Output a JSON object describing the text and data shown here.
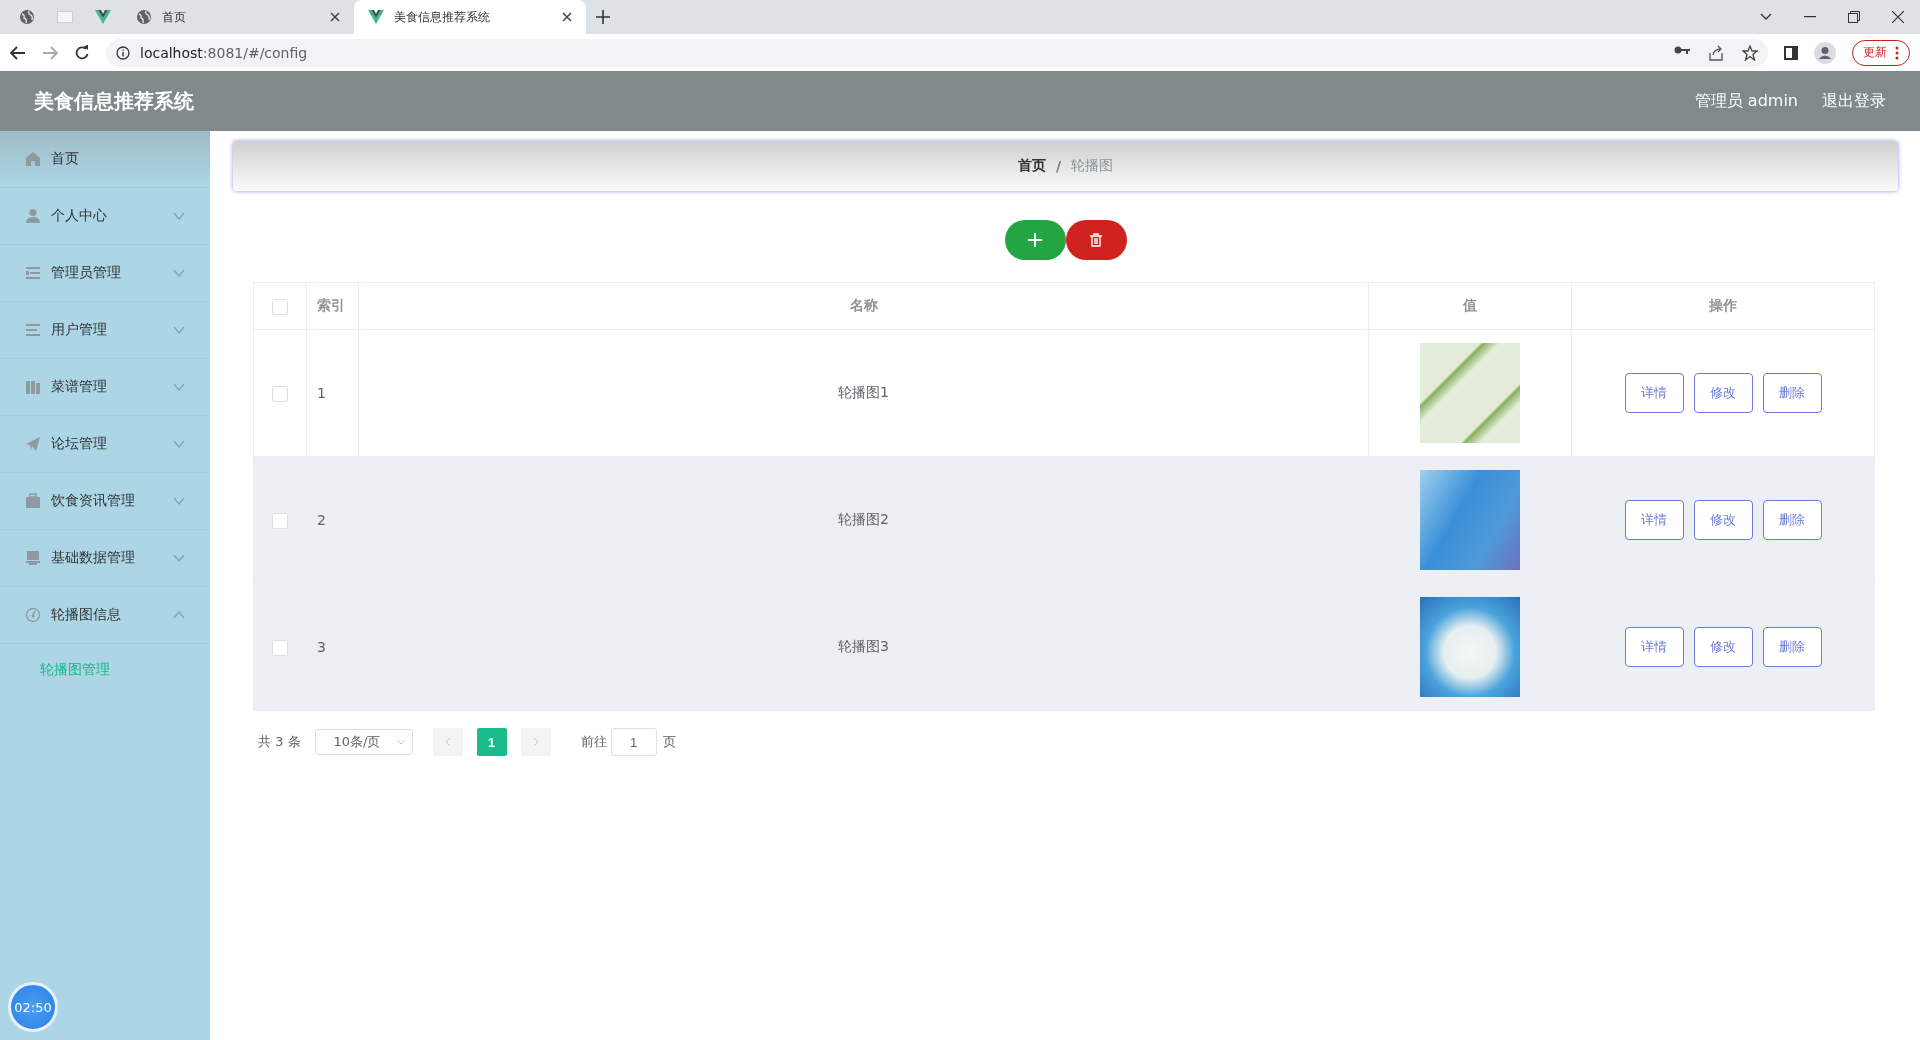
{
  "browser": {
    "tabs": [
      {
        "label": "首页",
        "selected": false
      },
      {
        "label": "美食信息推荐系统",
        "selected": true
      }
    ],
    "url_host": "localhost",
    "url_path": ":8081/#/config",
    "update_button": "更新"
  },
  "header": {
    "title": "美食信息推荐系统",
    "user": "管理员 admin",
    "logout": "退出登录"
  },
  "sidebar": {
    "items": [
      {
        "label": "首页",
        "kind": "link",
        "highlighted": true
      },
      {
        "label": "个人中心",
        "kind": "submenu",
        "expanded": false,
        "highlighted": false
      },
      {
        "label": "管理员管理",
        "kind": "submenu",
        "expanded": false,
        "highlighted": false
      },
      {
        "label": "用户管理",
        "kind": "submenu",
        "expanded": false,
        "highlighted": false
      },
      {
        "label": "菜谱管理",
        "kind": "submenu",
        "expanded": false,
        "highlighted": false
      },
      {
        "label": "论坛管理",
        "kind": "submenu",
        "expanded": false,
        "highlighted": false
      },
      {
        "label": "饮食资讯管理",
        "kind": "submenu",
        "expanded": false,
        "highlighted": false
      },
      {
        "label": "基础数据管理",
        "kind": "submenu",
        "expanded": false,
        "highlighted": false
      },
      {
        "label": "轮播图信息",
        "kind": "submenu",
        "expanded": true,
        "highlighted": false,
        "children": [
          {
            "label": "轮播图管理",
            "selected": true
          }
        ]
      }
    ]
  },
  "breadcrumb": [
    "首页",
    "轮播图"
  ],
  "breadcrumb_separator": "/",
  "table": {
    "columns": [
      "索引",
      "名称",
      "值",
      "操作"
    ],
    "all_checked": false,
    "rows": [
      {
        "checked": false,
        "highlighted": false,
        "index": "1",
        "name": "轮播图1",
        "actions": [
          "详情",
          "修改",
          "删除"
        ]
      },
      {
        "checked": false,
        "highlighted": true,
        "index": "2",
        "name": "轮播图2",
        "actions": [
          "详情",
          "修改",
          "删除"
        ]
      },
      {
        "checked": false,
        "highlighted": true,
        "index": "3",
        "name": "轮播图3",
        "actions": [
          "详情",
          "修改",
          "删除"
        ]
      }
    ]
  },
  "pagination": {
    "total": "共 3 条",
    "page_size": "10条/页",
    "pages": [
      {
        "label": "1",
        "selected": true
      }
    ],
    "jump_label": "前往",
    "jump_value": "1",
    "jump_suffix": "页"
  },
  "timer": "02:50"
}
